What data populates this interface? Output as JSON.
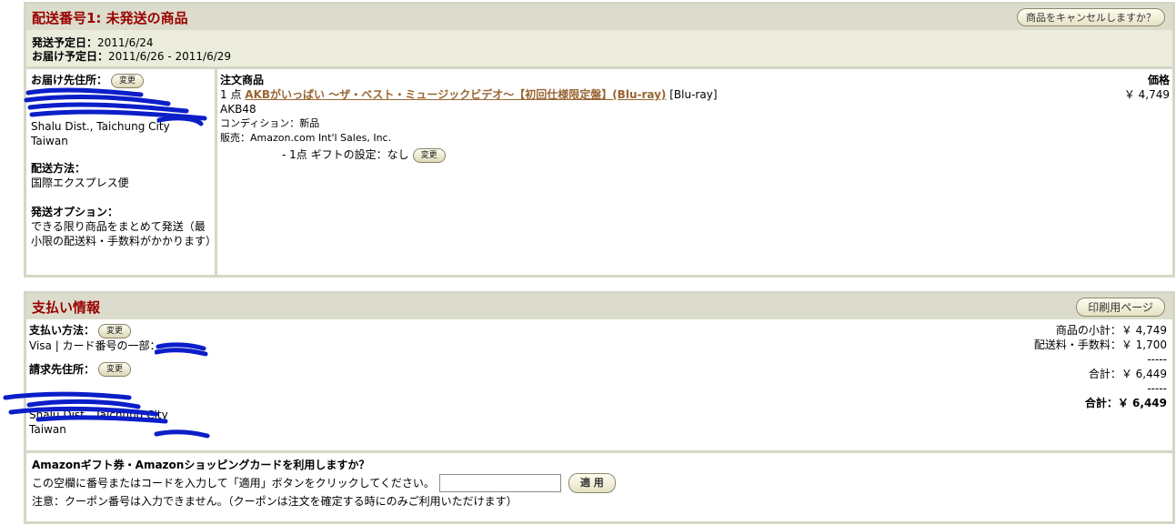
{
  "shipment": {
    "title": "配送番号1: 未発送の商品",
    "cancel_button": "商品をキャンセルしますか？",
    "ship_label": "発送予定日：",
    "ship_date": "2011/6/24",
    "deliver_label": "お届け予定日：",
    "deliver_date": "2011/6/26 - 2011/6/29",
    "address_label": "お届け先住所：",
    "change_label": "変更",
    "address_city": "Shalu Dist., Taichung City",
    "address_country": "Taiwan",
    "method_label": "配送方法：",
    "method_value": "国際エクスプレス便",
    "option_label": "発送オプション：",
    "option_value": "できる限り商品をまとめて発送（最小限の配送料・手数料がかかります）"
  },
  "order": {
    "col_items": "注文商品",
    "col_price": "価格",
    "qty": "1 点",
    "title": "AKBがいっぱい ～ザ・ベスト・ミュージックビデオ～【初回仕様限定盤】(Blu-ray)",
    "format": "[Blu-ray]",
    "price": "￥ 4,749",
    "artist": "AKB48",
    "condition_label": "コンディション：",
    "condition_value": "新品",
    "seller_label": "販売：",
    "seller_value": "Amazon.com Int'l Sales, Inc.",
    "gift_text": "- 1点 ギフトの設定：なし"
  },
  "payment": {
    "title": "支払い情報",
    "print_button": "印刷用ページ",
    "method_label": "支払い方法：",
    "card_text": "Visa | カード番号の一部：",
    "billing_label": "請求先住所：",
    "billing_city": "Shalu Dist., Taichung City",
    "billing_country": "Taiwan",
    "subtotal_label": "商品の小計：",
    "subtotal_value": "￥ 4,749",
    "shipping_label": "配送料・手数料：",
    "shipping_value": "￥ 1,700",
    "dash": "-----",
    "total_label": "合計：",
    "total_value": "￥ 6,449",
    "grand_label": "合計：",
    "grand_value": "￥ 6,449"
  },
  "gift_card": {
    "title": "Amazonギフト券・Amazonショッピングカードを利用しますか？",
    "instruction": "この空欄に番号またはコードを入力して「適用」ボタンをクリックしてください。",
    "input_value": "",
    "apply_button": "適 用",
    "note": "注意：クーポン番号は入力できません。（クーポンは注文を確定する時にのみご利用いただけます）"
  }
}
